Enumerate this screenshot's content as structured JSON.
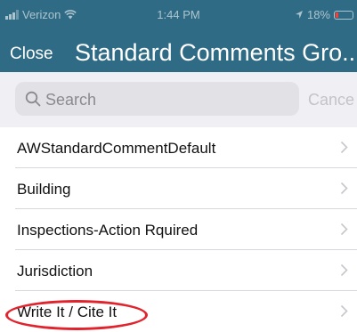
{
  "status_bar": {
    "carrier": "Verizon",
    "time": "1:44 PM",
    "battery": "18%",
    "battery_level": 0.18
  },
  "nav": {
    "close_label": "Close",
    "title": "Standard Comments Gro..."
  },
  "search": {
    "placeholder": "Search",
    "cancel_label": "Cance"
  },
  "list": {
    "items": [
      {
        "label": "AWStandardCommentDefault"
      },
      {
        "label": "Building"
      },
      {
        "label": "Inspections-Action Rquired"
      },
      {
        "label": "Jurisdiction"
      },
      {
        "label": "Write It / Cite It"
      }
    ]
  },
  "colors": {
    "header": "#2f6b84",
    "highlight": "#e0232c"
  }
}
